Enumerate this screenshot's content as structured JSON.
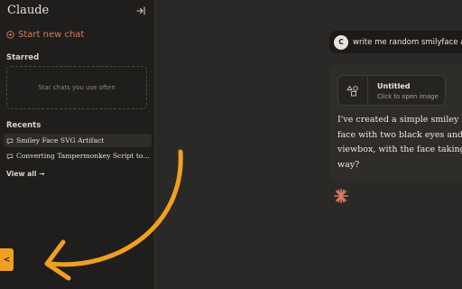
{
  "sidebar": {
    "logo": "Claude",
    "start_chat": "Start new chat",
    "starred_heading": "Starred",
    "starred_empty": "Star chats you use often",
    "recents_heading": "Recents",
    "recents": [
      {
        "title": "Smiley Face SVG Artifact"
      },
      {
        "title": "Converting Tampermonkey Script to ..."
      }
    ],
    "view_all": "View all →",
    "toggle_label": "<"
  },
  "chat": {
    "user_avatar": "C",
    "user_message": "write me random smilyface as",
    "artifact": {
      "title": "Untitled",
      "subtitle": "Click to open image"
    },
    "reply_lines": [
      "I've created a simple smiley face",
      "face with two black eyes and a cu",
      "viewbox, with the face taking up",
      "way?"
    ]
  },
  "colors": {
    "accent": "#d97a5a",
    "highlight_arrow": "#f0a020"
  }
}
